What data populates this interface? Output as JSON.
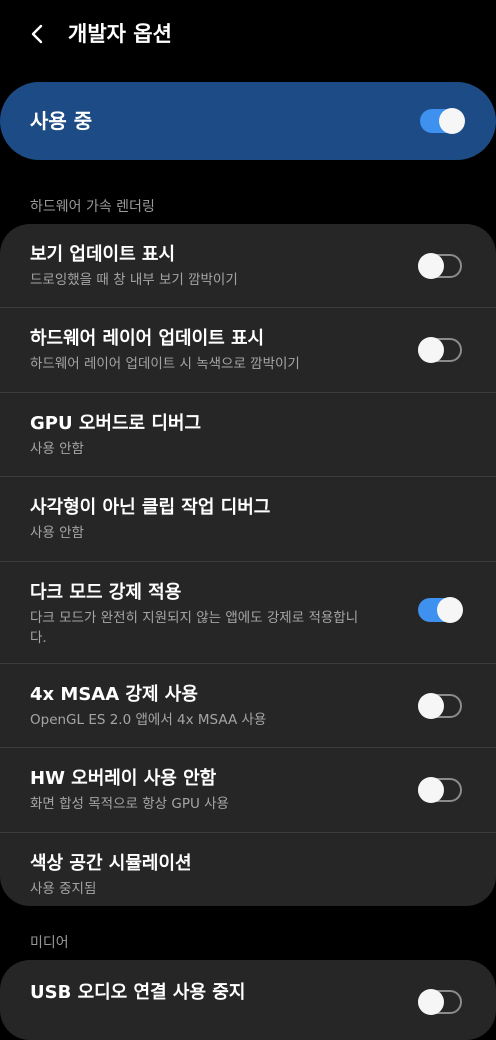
{
  "header": {
    "title": "개발자 옵션",
    "back_icon": "chevron-left-icon"
  },
  "master": {
    "label": "사용 중",
    "toggle_on": true
  },
  "colors": {
    "accent": "#3e91ee",
    "master_bg": "#1c4b86",
    "card_bg": "#262626"
  },
  "sections": {
    "hw_rendering": {
      "header": "하드웨어 가속 렌더링",
      "items": [
        {
          "title": "보기 업데이트 표시",
          "subtitle": "드로잉했을 때 창 내부 보기 깜박이기",
          "toggle_on": false
        },
        {
          "title": "하드웨어 레이어 업데이트 표시",
          "subtitle": "하드웨어 레이어 업데이트 시 녹색으로 깜박이기",
          "toggle_on": false
        },
        {
          "title": "GPU 오버드로 디버그",
          "subtitle": "사용 안함"
        },
        {
          "title": "사각형이 아닌 클립 작업 디버그",
          "subtitle": "사용 안함"
        },
        {
          "title": "다크 모드 강제 적용",
          "subtitle": "다크 모드가 완전히 지원되지 않는 앱에도 강제로 적용합니다.",
          "toggle_on": true
        },
        {
          "title": "4x MSAA 강제 사용",
          "subtitle": "OpenGL ES 2.0 앱에서 4x MSAA 사용",
          "toggle_on": false
        },
        {
          "title": "HW 오버레이 사용 안함",
          "subtitle": "화면 합성 목적으로 항상 GPU 사용",
          "toggle_on": false
        },
        {
          "title": "색상 공간 시뮬레이션",
          "subtitle": "사용 중지됨"
        }
      ]
    },
    "media": {
      "header": "미디어",
      "items": [
        {
          "title": "USB 오디오 연결 사용 중지",
          "toggle_on": false
        }
      ]
    }
  }
}
